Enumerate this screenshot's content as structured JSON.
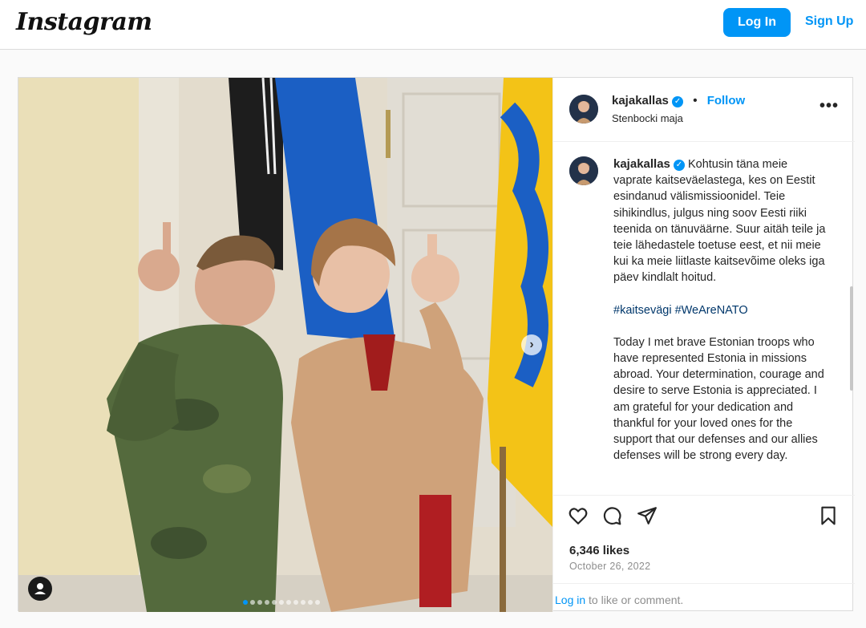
{
  "app": {
    "logo_text": "Instagram"
  },
  "header": {
    "login_label": "Log In",
    "signup_label": "Sign Up"
  },
  "post": {
    "username": "kajakallas",
    "verified": true,
    "follow_label": "Follow",
    "location": "Stenbocki maja",
    "caption": {
      "estonian": "Kohtusin täna meie vaprate kaitseväelastega, kes on Eestit esindanud välismissioonidel. Teie sihikindlus, julgus ning soov Eesti riiki teenida on tänuväärne. Suur aitäh teile ja teie lähedastele toetuse eest, et nii meie kui ka meie liitlaste kaitsevõime oleks iga päev kindlalt hoitud.",
      "hashtags": "#kaitsevägi #WeAreNATO",
      "english": "Today I met brave Estonian troops who have represented Estonia in missions abroad. Your determination, courage and desire to serve Estonia is appreciated. I am grateful for your dedication and thankful for your loved ones for the support that our defenses and our allies defenses will be strong every day."
    },
    "likes": "6,346 likes",
    "date": "October 26, 2022",
    "footer_login": "Log in",
    "footer_rest": " to like or comment.",
    "carousel_count": 11,
    "carousel_active": 0
  },
  "colors": {
    "accent": "#0095f6",
    "flag_blue": "#1b5fc4",
    "flag_yellow": "#f3c317"
  },
  "icons": [
    "heart-icon",
    "comment-icon",
    "share-icon",
    "bookmark-icon",
    "more-icon",
    "verified-icon",
    "chevron-right-icon",
    "user-tag-icon"
  ]
}
